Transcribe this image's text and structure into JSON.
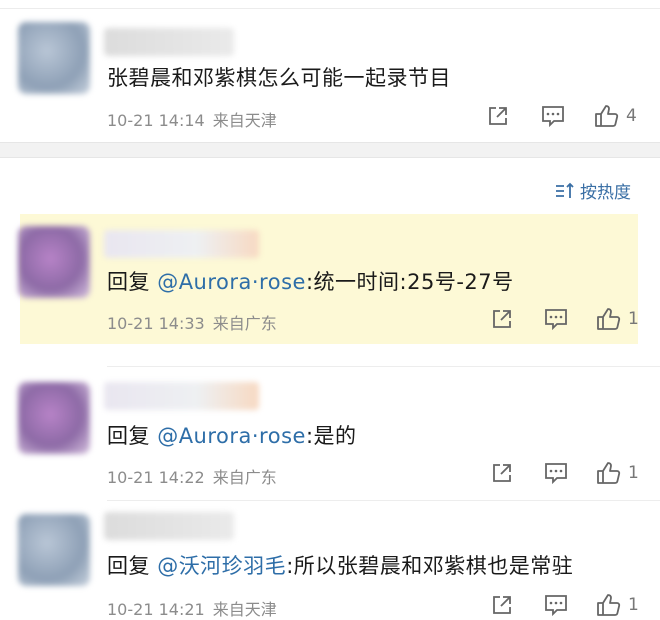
{
  "comments": [
    {
      "text": "张碧晨和邓紫棋怎么可能一起录节目",
      "time": "10-21 14:14",
      "source": "来自天津",
      "likes": "4"
    },
    {
      "reply_prefix": "回复",
      "mention": "@Aurora·rose",
      "body": ":统一时间:25号-27号",
      "time": "10-21 14:33",
      "source": "来自广东",
      "likes": "1"
    },
    {
      "reply_prefix": "回复",
      "mention": "@Aurora·rose",
      "body": ":是的",
      "time": "10-21 14:22",
      "source": "来自广东",
      "likes": "1"
    },
    {
      "reply_prefix": "回复",
      "mention": "@沃河珍羽毛",
      "body": ":所以张碧晨和邓紫棋也是常驻",
      "time": "10-21 14:21",
      "source": "来自天津",
      "likes": "1"
    }
  ],
  "sort": {
    "label": "按热度",
    "icon": "sort-icon"
  },
  "icons": {
    "share": "share-icon",
    "reply": "comment-icon",
    "like": "thumbs-up-icon"
  },
  "colors": {
    "mention": "#2e6ea8",
    "highlight": "#fdf9d6",
    "meta": "#8c8c8c"
  }
}
